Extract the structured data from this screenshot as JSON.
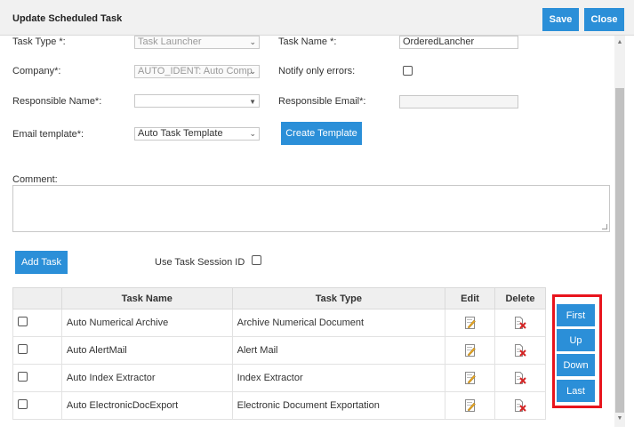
{
  "dialog": {
    "title": "Update Scheduled Task",
    "save_label": "Save",
    "close_label": "Close"
  },
  "form": {
    "task_type_label": "Task Type *:",
    "task_type_value": "Task Launcher",
    "task_name_label": "Task Name *:",
    "task_name_value": "OrderedLancher",
    "company_label": "Company*:",
    "company_value": "AUTO_IDENT: Auto Comp",
    "notify_label": "Notify only errors:",
    "responsible_name_label": "Responsible Name*:",
    "responsible_name_value": "",
    "responsible_email_label": "Responsible Email*:",
    "responsible_email_value": "",
    "email_template_label": "Email template*:",
    "email_template_value": "Auto Task Template",
    "create_template_label": "Create Template",
    "comment_label": "Comment:"
  },
  "tasks": {
    "add_task_label": "Add Task",
    "session_id_label": "Use Task Session ID",
    "columns": {
      "name": "Task Name",
      "type": "Task Type",
      "edit": "Edit",
      "delete": "Delete"
    },
    "rows": [
      {
        "name": "Auto Numerical Archive",
        "type": "Archive Numerical Document"
      },
      {
        "name": "Auto AlertMail",
        "type": "Alert Mail"
      },
      {
        "name": "Auto Index Extractor",
        "type": "Index Extractor"
      },
      {
        "name": "Auto ElectronicDocExport",
        "type": "Electronic Document Exportation"
      }
    ]
  },
  "order_buttons": {
    "first": "First",
    "up": "Up",
    "down": "Down",
    "last": "Last"
  },
  "icons": {
    "edit": "edit-document-icon",
    "delete": "delete-document-icon",
    "caret": "chevron-down-icon"
  },
  "colors": {
    "accent": "#2b8fd8",
    "highlight": "#e8141d"
  }
}
